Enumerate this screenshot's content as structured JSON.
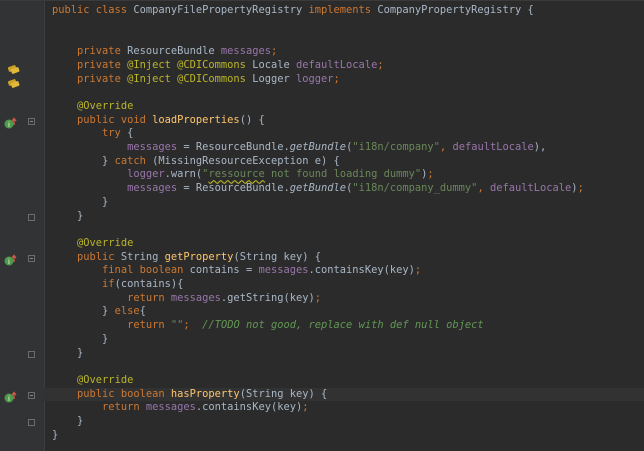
{
  "editor": {
    "lines": [
      {
        "parts": [
          [
            "kw",
            "public class "
          ],
          [
            "",
            "CompanyFilePropertyRegistry "
          ],
          [
            "kw",
            "implements "
          ],
          [
            "",
            "CompanyPropertyRegistry {"
          ]
        ]
      },
      {
        "parts": []
      },
      {
        "parts": []
      },
      {
        "parts": [
          [
            "",
            "    "
          ],
          [
            "kw",
            "private "
          ],
          [
            "",
            "ResourceBundle "
          ],
          [
            "fld",
            "messages"
          ],
          [
            "kw",
            ";"
          ]
        ]
      },
      {
        "parts": [
          [
            "",
            "    "
          ],
          [
            "kw",
            "private "
          ],
          [
            "ann",
            "@Inject @CDICommons "
          ],
          [
            "",
            "Locale "
          ],
          [
            "fld",
            "defaultLocale"
          ],
          [
            "kw",
            ";"
          ]
        ]
      },
      {
        "parts": [
          [
            "",
            "    "
          ],
          [
            "kw",
            "private "
          ],
          [
            "ann",
            "@Inject @CDICommons "
          ],
          [
            "",
            "Logger "
          ],
          [
            "fld",
            "logger"
          ],
          [
            "kw",
            ";"
          ]
        ]
      },
      {
        "parts": []
      },
      {
        "parts": [
          [
            "",
            "    "
          ],
          [
            "ann",
            "@Override"
          ]
        ]
      },
      {
        "parts": [
          [
            "",
            "    "
          ],
          [
            "kw",
            "public void "
          ],
          [
            "fn",
            "loadProperties"
          ],
          [
            "",
            "() {"
          ]
        ]
      },
      {
        "parts": [
          [
            "",
            "        "
          ],
          [
            "kw",
            "try "
          ],
          [
            "",
            "{"
          ]
        ]
      },
      {
        "parts": [
          [
            "",
            "            "
          ],
          [
            "fld",
            "messages "
          ],
          [
            "",
            "= ResourceBundle."
          ],
          [
            "it",
            "getBundle"
          ],
          [
            "",
            "("
          ],
          [
            "str",
            "\"i18n/company\""
          ],
          [
            "kw",
            ", "
          ],
          [
            "fld",
            "defaultLocale"
          ],
          [
            "",
            "),"
          ]
        ]
      },
      {
        "parts": [
          [
            "",
            "        } "
          ],
          [
            "kw",
            "catch "
          ],
          [
            "",
            "(MissingResourceException e) {"
          ]
        ]
      },
      {
        "parts": [
          [
            "",
            "            "
          ],
          [
            "fld",
            "logger"
          ],
          [
            "",
            ".warn("
          ],
          [
            "str",
            "\""
          ],
          [
            "strwarn",
            "ressource"
          ],
          [
            "str",
            " not found loading dummy\""
          ],
          [
            "",
            ")"
          ],
          [
            "kw",
            ";"
          ]
        ]
      },
      {
        "parts": [
          [
            "",
            "            "
          ],
          [
            "fld",
            "messages "
          ],
          [
            "",
            "= ResourceBundle."
          ],
          [
            "it",
            "getBundle"
          ],
          [
            "",
            "("
          ],
          [
            "str",
            "\"i18n/company_dummy\""
          ],
          [
            "kw",
            ", "
          ],
          [
            "fld",
            "defaultLocale"
          ],
          [
            "",
            ")"
          ],
          [
            "kw",
            ";"
          ]
        ]
      },
      {
        "parts": [
          [
            "",
            "        }"
          ]
        ]
      },
      {
        "parts": [
          [
            "",
            "    }"
          ]
        ]
      },
      {
        "parts": []
      },
      {
        "parts": [
          [
            "",
            "    "
          ],
          [
            "ann",
            "@Override"
          ]
        ]
      },
      {
        "parts": [
          [
            "",
            "    "
          ],
          [
            "kw",
            "public "
          ],
          [
            "",
            "String "
          ],
          [
            "fn",
            "getProperty"
          ],
          [
            "",
            "(String key) {"
          ]
        ]
      },
      {
        "parts": [
          [
            "",
            "        "
          ],
          [
            "kw",
            "final boolean "
          ],
          [
            "",
            "contains = "
          ],
          [
            "fld",
            "messages"
          ],
          [
            "",
            ".containsKey(key)"
          ],
          [
            "kw",
            ";"
          ]
        ]
      },
      {
        "parts": [
          [
            "",
            "        "
          ],
          [
            "kw",
            "if"
          ],
          [
            "",
            "(contains){"
          ]
        ]
      },
      {
        "parts": [
          [
            "",
            "            "
          ],
          [
            "kw",
            "return "
          ],
          [
            "fld",
            "messages"
          ],
          [
            "",
            ".getString(key)"
          ],
          [
            "kw",
            ";"
          ]
        ]
      },
      {
        "parts": [
          [
            "",
            "        } "
          ],
          [
            "kw",
            "else"
          ],
          [
            "",
            "{"
          ]
        ]
      },
      {
        "parts": [
          [
            "",
            "            "
          ],
          [
            "kw",
            "return "
          ],
          [
            "str",
            "\"\""
          ],
          [
            "kw",
            ";  "
          ],
          [
            "cmt",
            "//TODO not good, replace with def null object"
          ]
        ]
      },
      {
        "parts": [
          [
            "",
            "        }"
          ]
        ]
      },
      {
        "parts": [
          [
            "",
            "    }"
          ]
        ]
      },
      {
        "parts": []
      },
      {
        "parts": [
          [
            "",
            "    "
          ],
          [
            "ann",
            "@Override"
          ]
        ]
      },
      {
        "parts": [
          [
            "",
            "    "
          ],
          [
            "kw",
            "public boolean "
          ],
          [
            "fn",
            "hasProperty"
          ],
          [
            "",
            "(String key) {"
          ]
        ]
      },
      {
        "parts": [
          [
            "",
            "        "
          ],
          [
            "kw",
            "return "
          ],
          [
            "fld",
            "messages"
          ],
          [
            "",
            ".containsKey(key)"
          ],
          [
            "kw",
            ";"
          ]
        ]
      },
      {
        "parts": [
          [
            "",
            "    }"
          ]
        ]
      },
      {
        "parts": [
          [
            "",
            "}"
          ]
        ]
      }
    ],
    "current_line": 28,
    "gutter_icons": [
      {
        "line": 4,
        "icon": "bean-injection-icon"
      },
      {
        "line": 5,
        "icon": "bean-injection-icon"
      },
      {
        "line": 8,
        "icon": "implements-method-icon"
      },
      {
        "line": 18,
        "icon": "implements-method-icon"
      },
      {
        "line": 28,
        "icon": "implements-method-icon"
      }
    ],
    "fold_markers": [
      {
        "line": 8,
        "state": "open"
      },
      {
        "line": 15,
        "state": "end"
      },
      {
        "line": 18,
        "state": "open"
      },
      {
        "line": 25,
        "state": "end"
      },
      {
        "line": 28,
        "state": "open"
      },
      {
        "line": 30,
        "state": "end"
      }
    ],
    "colors": {
      "background": "#2b2b2b",
      "gutter": "#313335",
      "keyword": "#cc7832",
      "field": "#9876aa",
      "annotation": "#bbb529",
      "string": "#6a8759",
      "method": "#ffc66d",
      "comment": "#629755",
      "text": "#a9b7c6"
    }
  }
}
